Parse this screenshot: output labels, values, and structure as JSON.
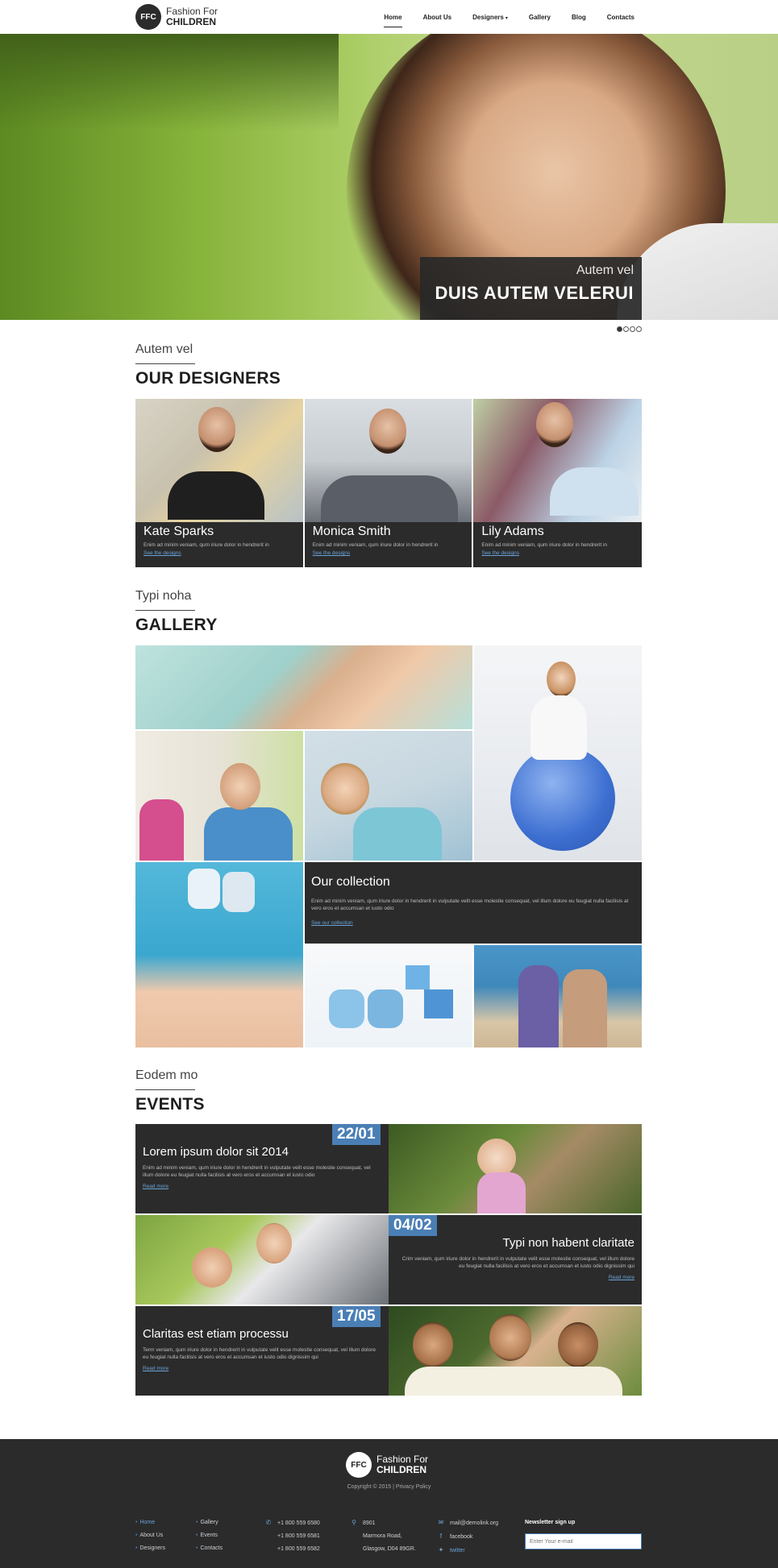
{
  "header": {
    "logo_badge": "FFC",
    "logo_line1": "Fashion For",
    "logo_line2": "CHILDREN",
    "nav": [
      "Home",
      "About Us",
      "Designers",
      "Gallery",
      "Blog",
      "Contacts"
    ],
    "active_nav": "Home"
  },
  "hero": {
    "caption_small": "Autem vel",
    "caption_big": "DUIS AUTEM VELERUI",
    "slide_count": 4,
    "active_slide": 1
  },
  "designers_section": {
    "subtitle": "Autem vel",
    "title": "OUR DESIGNERS",
    "items": [
      {
        "name": "Kate Sparks",
        "text": "Enim ad minim veniam, qum iriure dolor in hendrerit in",
        "link": "See the designs"
      },
      {
        "name": "Monica Smith",
        "text": "Enim ad minim veniam, qum iriure dolor in hendrerit in",
        "link": "See the designs"
      },
      {
        "name": "Lily Adams",
        "text": "Enim ad minim veniam, qum iriure dolor in hendrerit in",
        "link": "See the designs"
      }
    ]
  },
  "gallery_section": {
    "subtitle": "Typi noha",
    "title": "GALLERY",
    "collection_title": "Our collection",
    "collection_text": "Enim ad minim veniam, qum iriure dolor in hendrerit in vulputate velit esse molestie consequat, vel illum dolore eu feugiat nulla facilisis at vero eros et accumsan et iusto odio",
    "collection_link": "See our collection"
  },
  "events_section": {
    "subtitle": "Eodem mo",
    "title": "EVENTS",
    "items": [
      {
        "date": "22/01",
        "title": "Lorem ipsum dolor sit 2014",
        "text": "Enim ad minim veniam, qum iriure dolor in hendrerit in vulputate velit esse molestie consequat, vel illum dolore eu feugiat nulla facilisis at vero eros et accumsan et iusto odio",
        "link": "Read more"
      },
      {
        "date": "04/02",
        "title": "Typi non habent claritate",
        "text": "Crim veniam, qum iriure dolor in hendrerit in vulputate velit esse molestie consequat, vel illum dolore eu feugiat nulla facilisis at vero eros et accumsan et iusto odio dignissim qui",
        "link": "Read more"
      },
      {
        "date": "17/05",
        "title": "Claritas est etiam processu",
        "text": "Term veniam, qum iriure dolor in hendrerit in vulputate velit esse molestie consequat, vel illum dolore eu feugiat nulla facilisis at vero eros et accumsan et iusto odio dignissim qui",
        "link": "Read more"
      }
    ]
  },
  "footer": {
    "logo_badge": "FFC",
    "logo_line1": "Fashion For",
    "logo_line2": "CHILDREN",
    "copyright": "Copyright © 2015 | Privacy Policy",
    "links_col1": [
      "Home",
      "About Us",
      "Designers"
    ],
    "links_col2": [
      "Gallery",
      "Events",
      "Contacts"
    ],
    "phones": [
      "+1 800 559 6580",
      "+1 800 559 6581",
      "+1 800 559 6582"
    ],
    "address": [
      "8901",
      "Marmora Road,",
      "Glasgow, D04 89GR."
    ],
    "social": [
      "mail@demolink.org",
      "facebook",
      "twitter"
    ],
    "newsletter_title": "Newsletter sign up",
    "newsletter_placeholder": "Enter Your e-mail"
  },
  "colors": {
    "accent": "#4a7fb5",
    "link": "#6aa4d8",
    "dark_panel": "#2b2b2b"
  }
}
